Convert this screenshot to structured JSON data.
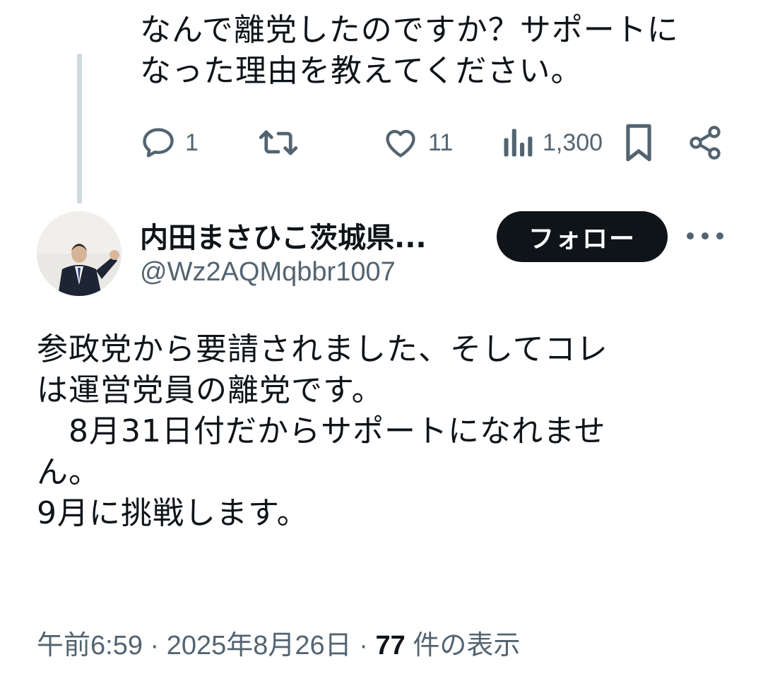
{
  "parent_tweet": {
    "text_lines": [
      "なんで離党したのですか？サポートに",
      "なった理由を教えてください。"
    ],
    "reply_count": "1",
    "retweet_count": "",
    "like_count": "11",
    "view_count": "1,300"
  },
  "reply_tweet": {
    "author_name": "内田まさひこ茨城県...",
    "author_handle": "@Wz2AQMqbbr1007",
    "follow_label": "フォロー",
    "text_lines": [
      "参政党から要請されました、そしてコレ",
      "は運営党員の離党です。",
      "　8月31日付だからサポートになれませ",
      "ん。",
      "9月に挑戦します。"
    ],
    "time": "午前6:59",
    "separator": "·",
    "date": "2025年8月26日",
    "views_count": "77",
    "views_label": "件の表示"
  },
  "icons": [
    "reply-icon",
    "retweet-icon",
    "like-icon",
    "views-icon",
    "bookmark-icon",
    "share-icon",
    "more-icon"
  ],
  "colors": {
    "text": "#0f1419",
    "secondary": "#536471",
    "thread_line": "#cfd9de",
    "follow_bg": "#0f1419"
  }
}
